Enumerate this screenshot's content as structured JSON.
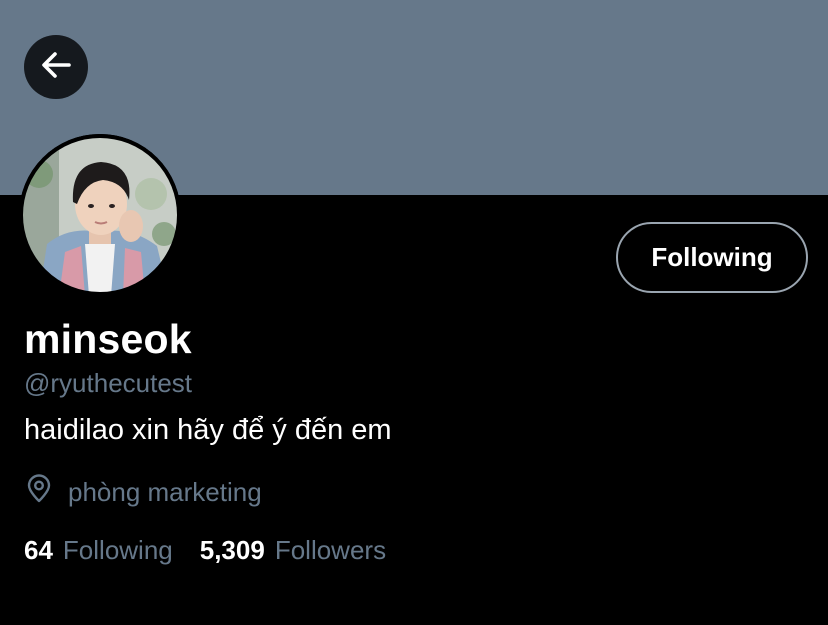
{
  "profile": {
    "banner_color": "#66788a",
    "back_icon": "arrow-left-icon",
    "avatar_alt": "profile photo",
    "follow_button_label": "Following",
    "display_name": "minseok",
    "handle": "@ryuthecutest",
    "bio": "haidilao xin hãy để ý đến em",
    "location_icon": "location-pin-icon",
    "location": "phòng marketing",
    "stats": {
      "following_count": "64",
      "following_label": "Following",
      "followers_count": "5,309",
      "followers_label": "Followers"
    }
  },
  "colors": {
    "background": "#000000",
    "banner": "#66788a",
    "muted_text": "#66788a",
    "primary_text": "#ffffff"
  }
}
